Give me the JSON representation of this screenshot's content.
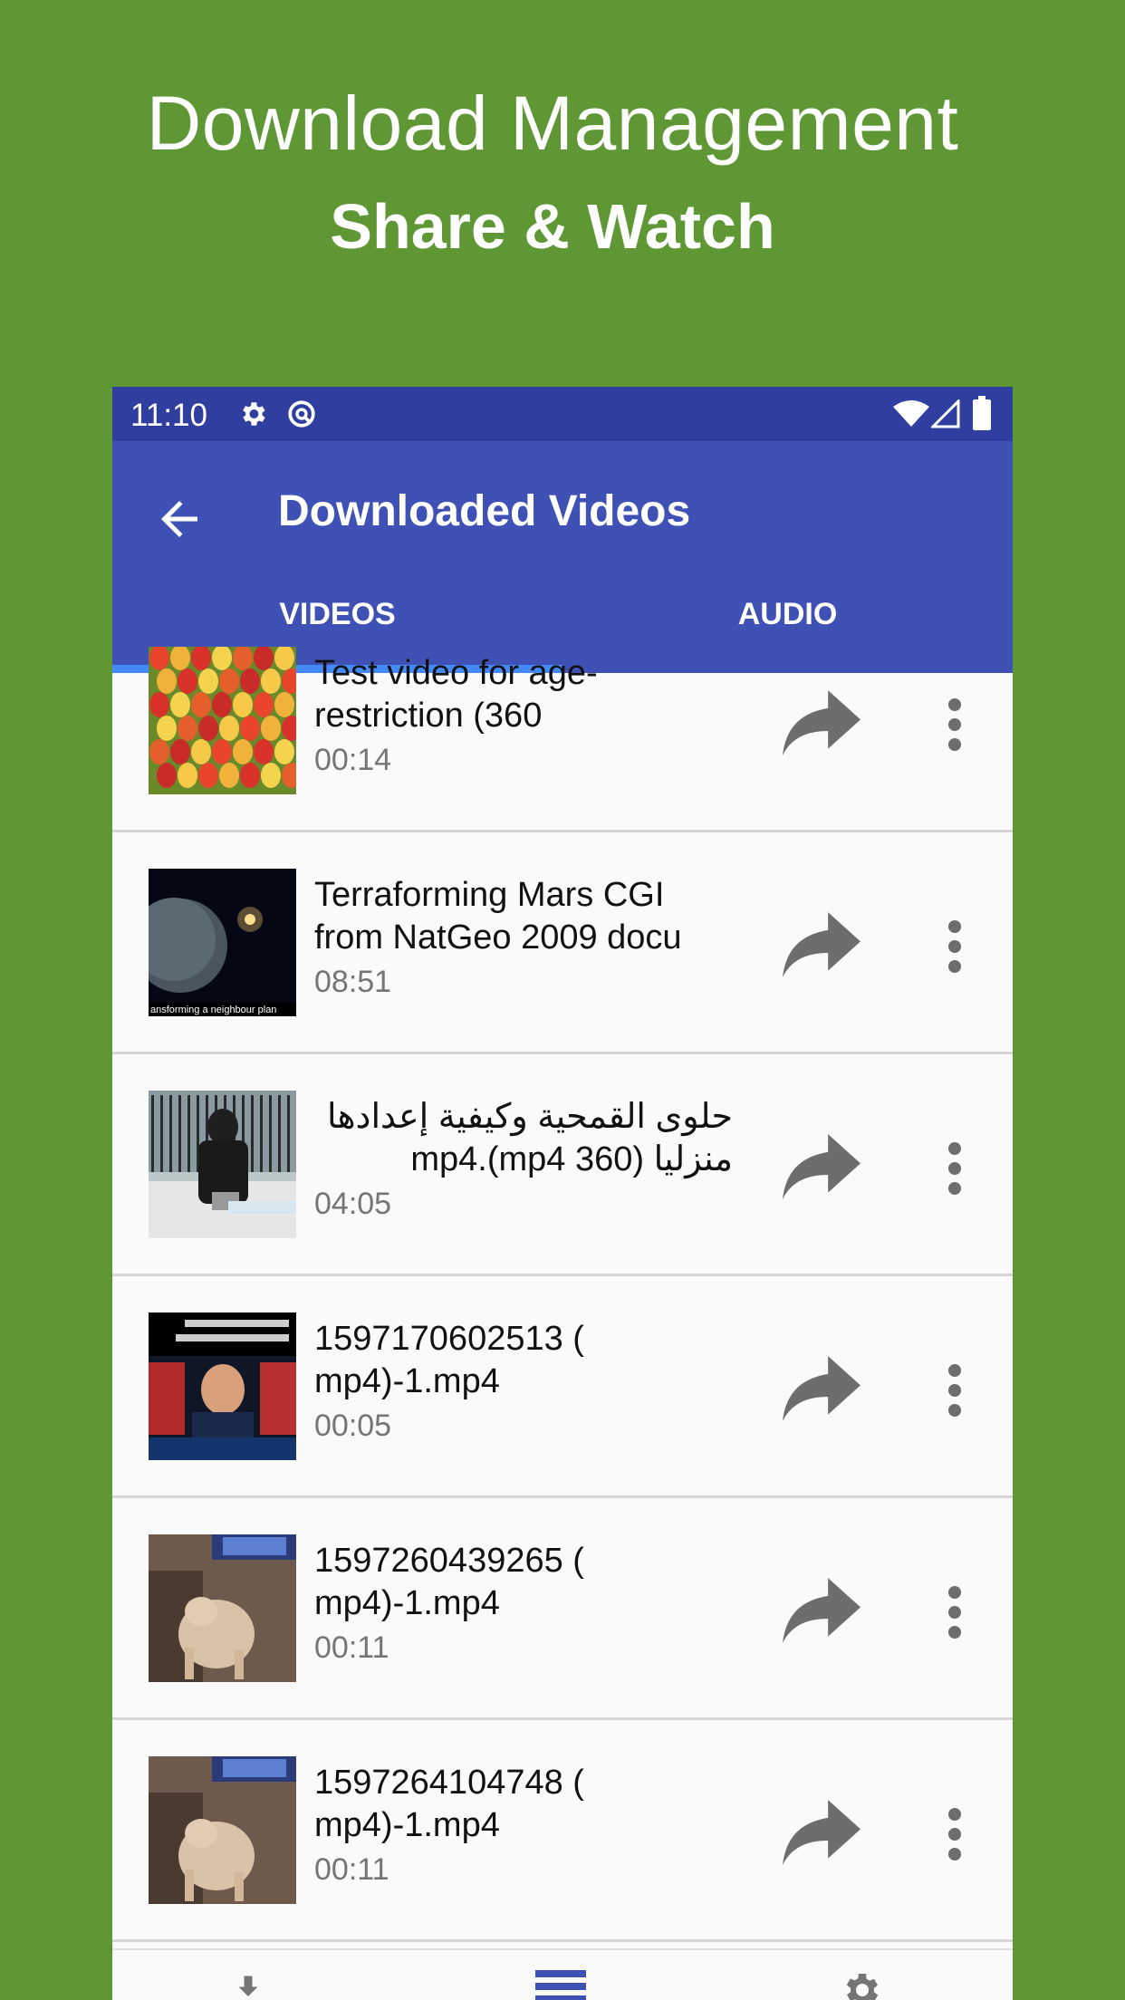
{
  "promo": {
    "title": "Download Management",
    "subtitle": "Share & Watch"
  },
  "status_bar": {
    "time": "11:10"
  },
  "app_bar": {
    "title": "Downloaded Videos"
  },
  "tabs": [
    {
      "label": "VIDEOS",
      "selected": true
    },
    {
      "label": "AUDIO",
      "selected": false
    }
  ],
  "videos": [
    {
      "title": "Test video for age-restriction (360",
      "duration": "00:14",
      "thumbnail": "tulips"
    },
    {
      "title": "Terraforming Mars CGI from NatGeo 2009 docu",
      "duration": "08:51",
      "thumbnail": "planet",
      "thumb_caption": "ansforming a neighbour plan"
    },
    {
      "title": "حلوى القمحية وكيفية إعدادها منزليا (360 mp4).mp4",
      "duration": "04:05",
      "thumbnail": "cooking-man"
    },
    {
      "title": "1597170602513 ( mp4)-1.mp4",
      "duration": "00:05",
      "thumbnail": "news"
    },
    {
      "title": "1597260439265 ( mp4)-1.mp4",
      "duration": "00:11",
      "thumbnail": "cat"
    },
    {
      "title": "1597264104748 ( mp4)-1.mp4",
      "duration": "00:11",
      "thumbnail": "cat"
    }
  ],
  "colors": {
    "background": "#5e9734",
    "status_bar": "#303f9f",
    "app_bar": "#3f51b5",
    "tab_indicator": "#448aff"
  },
  "icons": [
    "back-arrow-icon",
    "settings-icon",
    "vpn-icon",
    "wifi-icon",
    "signal-icon",
    "battery-icon",
    "share-icon",
    "more-vert-icon",
    "download-icon",
    "list-icon",
    "settings-gear-icon"
  ]
}
